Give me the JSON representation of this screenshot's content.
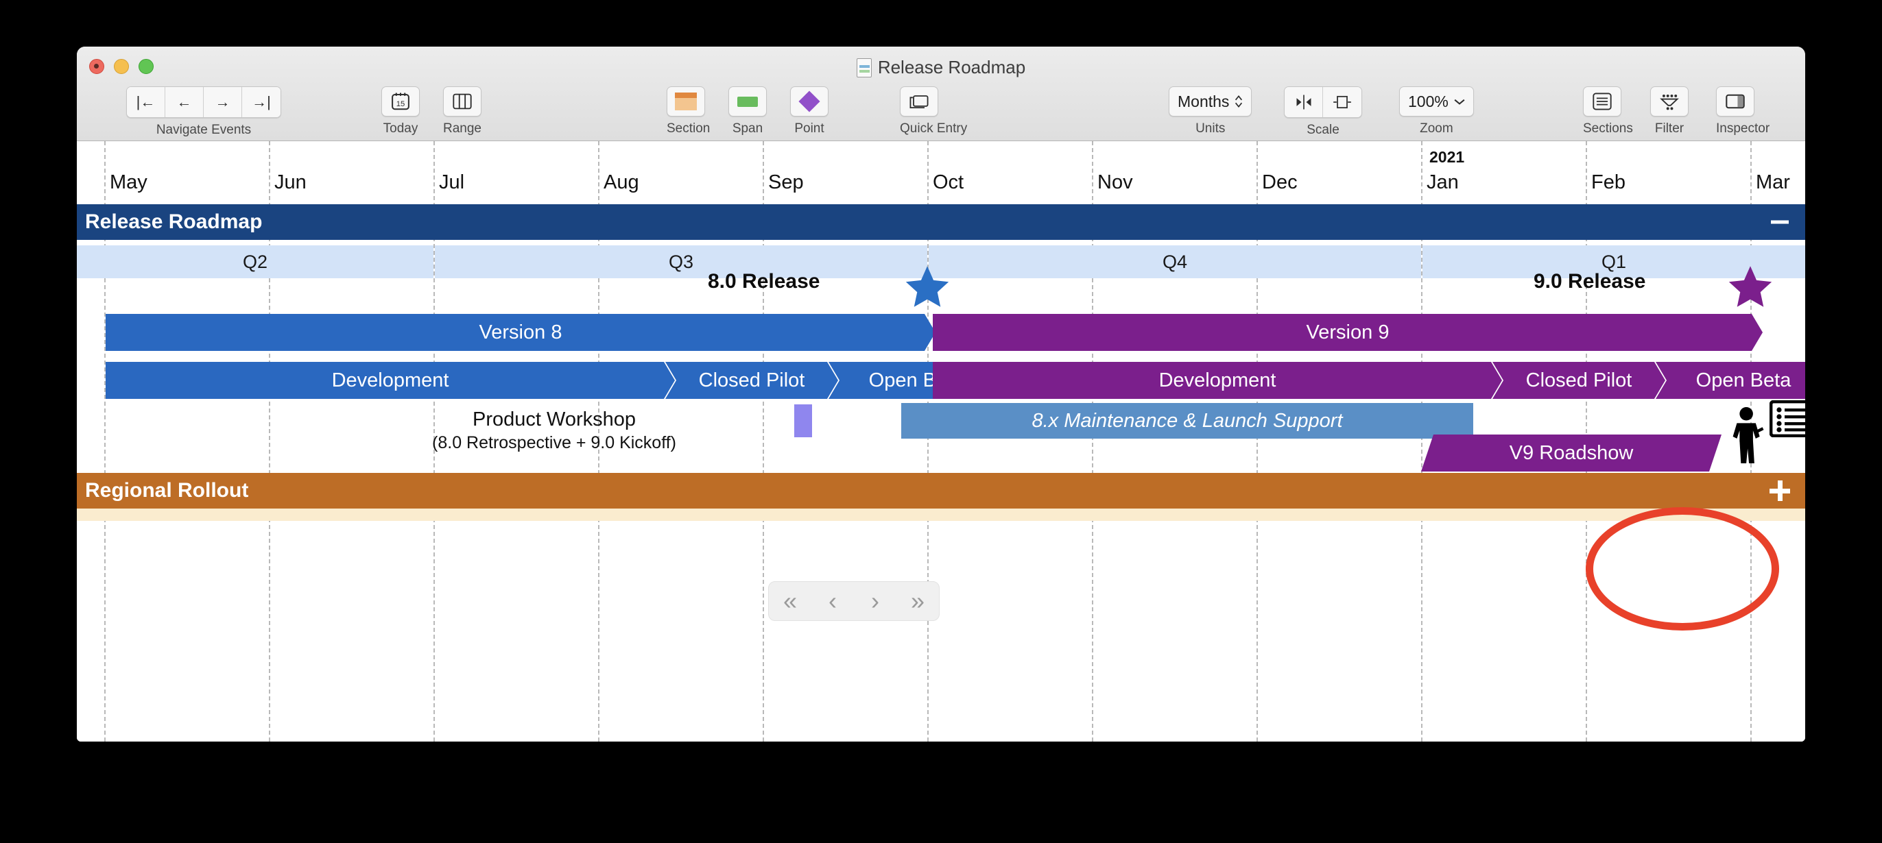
{
  "window": {
    "document_title": "Release Roadmap",
    "doc_icon": "document-icon",
    "traffic_lights": [
      "close-button",
      "minimize-button",
      "zoom-button"
    ]
  },
  "toolbar": {
    "navigate_events": {
      "label": "Navigate Events",
      "buttons": [
        {
          "name": "first-event-button",
          "glyph": "|←"
        },
        {
          "name": "previous-event-button",
          "glyph": "←"
        },
        {
          "name": "next-event-button",
          "glyph": "→"
        },
        {
          "name": "last-event-button",
          "glyph": "→|"
        }
      ]
    },
    "today": {
      "label": "Today",
      "icon": "calendar-15-icon",
      "day": "15"
    },
    "range": {
      "label": "Range",
      "icon": "columns-icon"
    },
    "section": {
      "label": "Section",
      "icon": "section-swatch-icon",
      "color": "#e0883f"
    },
    "span": {
      "label": "Span",
      "icon": "span-swatch-icon",
      "color": "#69bc5e"
    },
    "point": {
      "label": "Point",
      "icon": "diamond-icon",
      "color": "#9150c9"
    },
    "quick_entry": {
      "label": "Quick Entry",
      "icon": "cards-icon"
    },
    "units": {
      "label": "Units",
      "value": "Months",
      "icon": "updown-chevron-icon"
    },
    "scale": {
      "label": "Scale",
      "buttons": [
        {
          "name": "scale-shrink-button",
          "icon": "scale-in-icon"
        },
        {
          "name": "scale-expand-button",
          "icon": "scale-out-icon"
        }
      ]
    },
    "zoom": {
      "label": "Zoom",
      "value": "100%",
      "icon": "chevron-down-icon"
    },
    "sections": {
      "label": "Sections",
      "icon": "list-panel-icon"
    },
    "filter": {
      "label": "Filter",
      "icon": "funnel-icon"
    },
    "inspector": {
      "label": "Inspector",
      "icon": "right-panel-icon"
    }
  },
  "timeline": {
    "months": [
      "May",
      "Jun",
      "Jul",
      "Aug",
      "Sep",
      "Oct",
      "Nov",
      "Dec",
      "Jan",
      "Feb",
      "Mar"
    ],
    "year_marker": "2021",
    "year_marker_month": "Jan",
    "quarters": [
      "Q2",
      "Q3",
      "Q4",
      "Q1"
    ],
    "units": "Months"
  },
  "sections": [
    {
      "name": "Release Roadmap",
      "title": "Release Roadmap",
      "color": "#1a4480",
      "collapsed": false,
      "control": "collapse"
    },
    {
      "name": "Regional Rollout",
      "title": "Regional Rollout",
      "color": "#bd6d26",
      "collapsed": true,
      "control": "add"
    }
  ],
  "milestones": [
    {
      "label": "8.0 Release",
      "color": "#2a6fc4",
      "month": "Oct",
      "shape": "star"
    },
    {
      "label": "9.0 Release",
      "color": "#7b1f8c",
      "month": "Mar",
      "shape": "star"
    }
  ],
  "bars": {
    "versions": [
      {
        "label": "Version 8",
        "color": "#2a68c0",
        "shape": "chevron-right"
      },
      {
        "label": "Version 9",
        "color": "#7b1f8c",
        "shape": "chevron-right"
      }
    ],
    "phases_v8": [
      {
        "label": "Development",
        "color": "#2a68c0",
        "shape": "chevron-right"
      },
      {
        "label": "Closed Pilot",
        "color": "#2a68c0",
        "shape": "chevron-left-right"
      },
      {
        "label": "Open Beta",
        "color": "#2a68c0",
        "shape": "chevron-left-right"
      }
    ],
    "phases_v9": [
      {
        "label": "Development",
        "color": "#7b1f8c",
        "shape": "chevron-right"
      },
      {
        "label": "Closed Pilot",
        "color": "#7b1f8c",
        "shape": "chevron-left-right"
      },
      {
        "label": "Open Beta",
        "color": "#7b1f8c",
        "shape": "chevron-left-right"
      }
    ],
    "maintenance": {
      "label": "8.x Maintenance & Launch Support",
      "color": "#5a8fc6",
      "italic": true
    },
    "roadshow": {
      "label": "V9 Roadshow",
      "color": "#7b1f8c",
      "shape": "parallelogram"
    },
    "workshop_marker": {
      "color": "#8f86ee",
      "name": "product-workshop-marker"
    }
  },
  "annotations": {
    "workshop_title": "Product Workshop",
    "workshop_subtitle": "(8.0 Retrospective + 9.0 Kickoff)",
    "people_icon": "presenter-person-icon",
    "board_icon": "checklist-board-icon",
    "highlight_circle_color": "#e8412a",
    "highlight_target": "add-section-button"
  },
  "pager": {
    "buttons": [
      {
        "name": "page-first-button",
        "glyph": "«"
      },
      {
        "name": "page-previous-button",
        "glyph": "‹"
      },
      {
        "name": "page-next-button",
        "glyph": "›"
      },
      {
        "name": "page-last-button",
        "glyph": "»"
      }
    ]
  }
}
